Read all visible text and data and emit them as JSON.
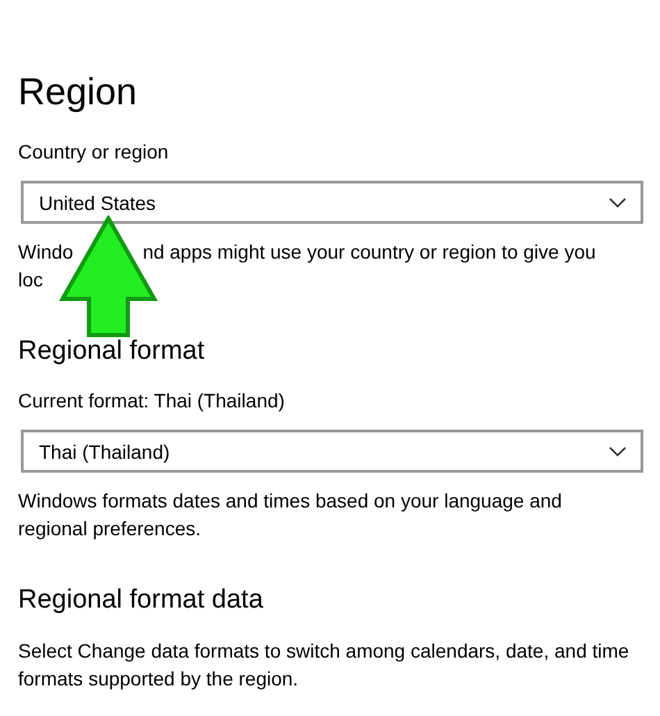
{
  "title": "Region",
  "sections": [
    {
      "kind": "dropdown",
      "label": "Country or region",
      "value": "United States",
      "note_lines": [
        [
          "Windo",
          "nd apps might use your country or region to give you"
        ],
        [
          "loc"
        ]
      ]
    },
    {
      "kind": "dropdown",
      "heading": "Regional format",
      "label": "Current format: Thai (Thailand)",
      "value": "Thai (Thailand)",
      "note": "Windows formats dates and times based on your language and regional preferences."
    },
    {
      "kind": "text",
      "heading": "Regional format data",
      "note": "Select Change data formats to switch among calendars, date, and time formats supported by the region."
    }
  ]
}
